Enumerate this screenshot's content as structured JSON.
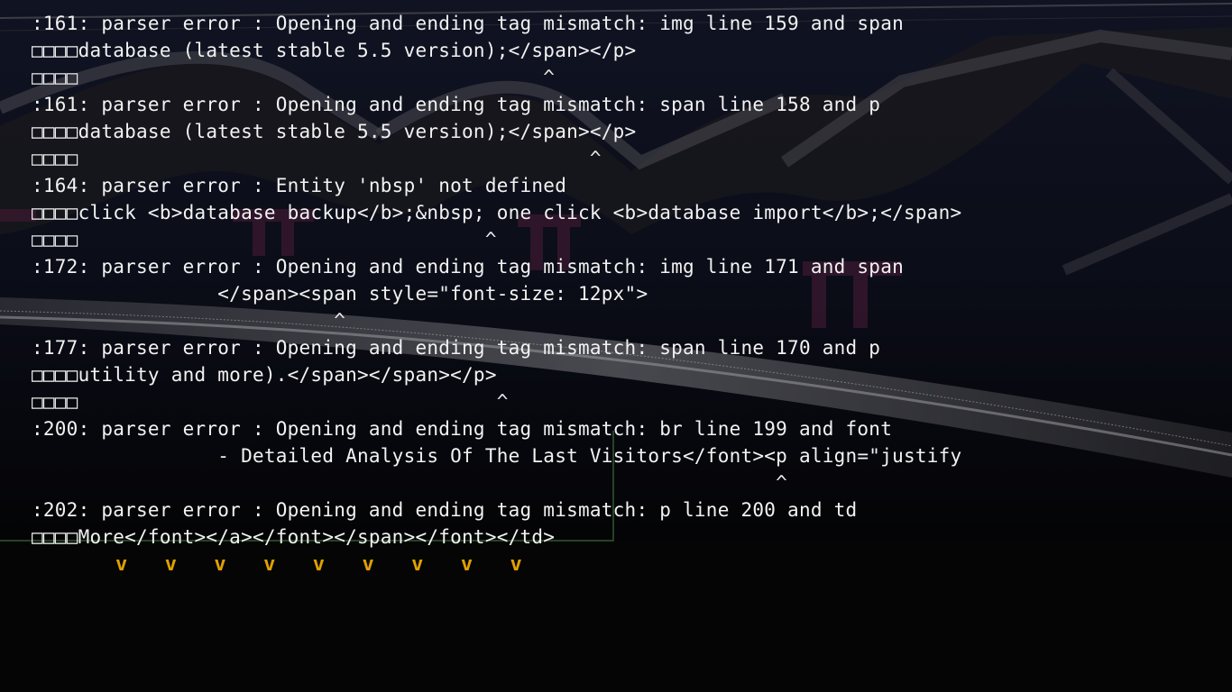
{
  "terminal": {
    "lines": [
      ":161: parser error : Opening and ending tag mismatch: img line 159 and span",
      "□□□□database (latest stable 5.5 version);</span></p>",
      "□□□□                                        ^",
      ":161: parser error : Opening and ending tag mismatch: span line 158 and p",
      "□□□□database (latest stable 5.5 version);</span></p>",
      "□□□□                                            ^",
      ":164: parser error : Entity 'nbsp' not defined",
      "□□□□click <b>database backup</b>;&nbsp; one click <b>database import</b>;</span>",
      "□□□□                                   ^",
      ":172: parser error : Opening and ending tag mismatch: img line 171 and span",
      "                </span><span style=\"font-size: 12px\">",
      "                          ^",
      ":177: parser error : Opening and ending tag mismatch: span line 170 and p",
      "□□□□utility and more).</span></span></p>",
      "□□□□                                    ^",
      ":200: parser error : Opening and ending tag mismatch: br line 199 and font",
      "                - Detailed Analysis Of The Last Visitors</font><p align=\"justify",
      "                                                                ^",
      ":202: parser error : Opening and ending tag mismatch: p line 200 and td",
      "□□□□More</font></a></font></span></font></td>"
    ],
    "marks": [
      "v",
      "v",
      "v",
      "v",
      "v",
      "v",
      "v",
      "v",
      "v"
    ]
  },
  "colors": {
    "background": "#000000",
    "text": "#f2f2f2",
    "marks": "#e0a000"
  }
}
